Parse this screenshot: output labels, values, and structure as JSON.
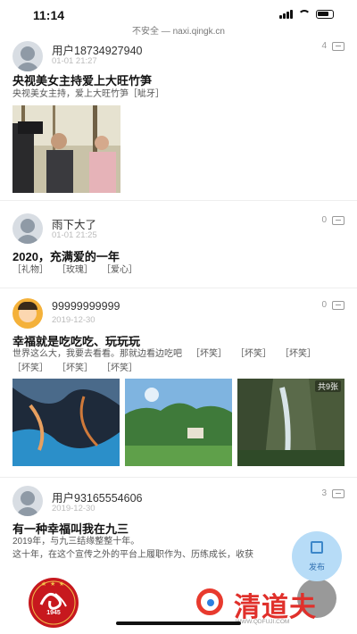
{
  "status": {
    "time": "11:14"
  },
  "browser": {
    "url_text": "不安全 — naxi.qingk.cn"
  },
  "posts": [
    {
      "user": "用户18734927940",
      "date": "01-01 21:27",
      "count": "4",
      "title": "央视美女主持爱上大旺竹笋",
      "text": "央视美女主持，爱上大旺竹笋［呲牙］"
    },
    {
      "user": "雨下大了",
      "date": "01-01 21:25",
      "count": "0",
      "title": "2020，充满爱的一年",
      "tags": [
        "［礼物］",
        "［玫瑰］",
        "［爱心］"
      ]
    },
    {
      "user": "99999999999",
      "date": "2019-12-30",
      "count": "0",
      "title": "幸福就是吃吃吃、玩玩玩",
      "text": "世界这么大，我要去看看。那就边看边吃吧",
      "tags": [
        "［坏笑］",
        "［坏笑］",
        "［坏笑］",
        "［坏笑］",
        "［坏笑］",
        "［坏笑］"
      ],
      "pic_count": "共9张"
    },
    {
      "user": "用户93165554606",
      "date": "2019-12-30",
      "count": "3",
      "title": "有一种幸福叫我在九三",
      "text1": "2019年，与九三结缘整整十年。",
      "text2": "这十年，在这个宣传之外的平台上履职作为、历练成长，收获"
    }
  ],
  "fab": {
    "label": "发布"
  },
  "logo": {
    "year": "1945"
  },
  "watermark": {
    "text": "清道夫",
    "url": "WWW.QDFUJI.COM"
  },
  "colors": {
    "accent": "#3c87c9",
    "fab_bg": "#b7dcf7",
    "watermark": "#e0302b"
  }
}
